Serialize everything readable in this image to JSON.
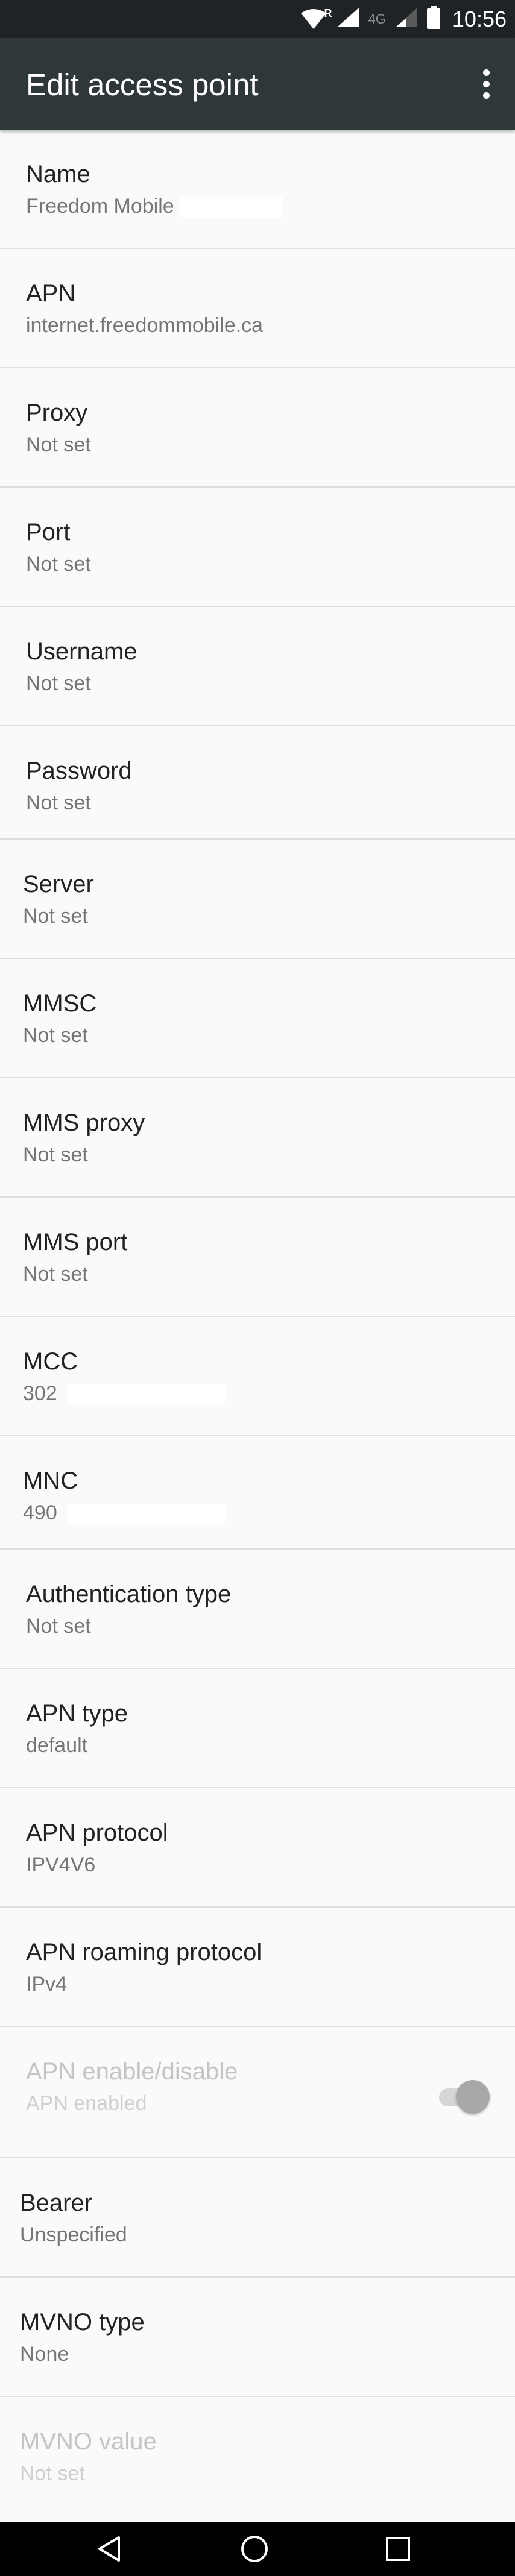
{
  "status_bar": {
    "time": "10:56",
    "roaming_label": "R",
    "network_label": "4G",
    "icons": [
      "wifi-icon",
      "signal-icon",
      "signal-weak-icon",
      "battery-icon"
    ]
  },
  "app_bar": {
    "title": "Edit access point",
    "overflow_icon": "more-vert-icon"
  },
  "preferences": [
    {
      "title": "Name",
      "summary": "Freedom Mobile"
    },
    {
      "title": "APN",
      "summary": "internet.freedommobile.ca"
    },
    {
      "title": "Proxy",
      "summary": "Not set"
    },
    {
      "title": "Port",
      "summary": "Not set"
    },
    {
      "title": "Username",
      "summary": "Not set"
    },
    {
      "title": "Password",
      "summary": "Not set"
    },
    {
      "title": "Server",
      "summary": "Not set"
    },
    {
      "title": "MMSC",
      "summary": "Not set"
    },
    {
      "title": "MMS proxy",
      "summary": "Not set"
    },
    {
      "title": "MMS port",
      "summary": "Not set"
    },
    {
      "title": "MCC",
      "summary": "302"
    },
    {
      "title": "MNC",
      "summary": "490"
    },
    {
      "title": "Authentication type",
      "summary": "Not set"
    },
    {
      "title": "APN type",
      "summary": "default"
    },
    {
      "title": "APN protocol",
      "summary": "IPV4V6"
    },
    {
      "title": "APN roaming protocol",
      "summary": "IPv4"
    },
    {
      "title": "APN enable/disable",
      "summary": "APN enabled",
      "toggle_on": true,
      "enabled": false
    },
    {
      "title": "Bearer",
      "summary": "Unspecified"
    },
    {
      "title": "MVNO type",
      "summary": "None"
    },
    {
      "title": "MVNO value",
      "summary": "Not set",
      "enabled": false
    }
  ],
  "nav_bar": {
    "back_icon": "back-icon",
    "home_icon": "home-icon",
    "recents_icon": "recents-icon"
  }
}
